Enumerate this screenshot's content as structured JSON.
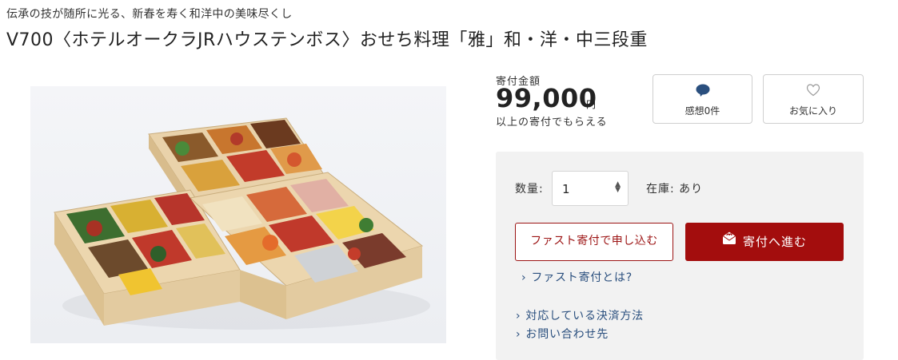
{
  "header": {
    "subtitle": "伝承の技が随所に光る、新春を寿く和洋中の美味尽くし",
    "title": "V700〈ホテルオークラJRハウステンボス〉おせち料理「雅」和・洋・中三段重"
  },
  "price": {
    "label": "寄付金額",
    "amount": "99,000",
    "unit": "円",
    "note": "以上の寄付でもらえる"
  },
  "actions": {
    "thanks_label": "感想0件",
    "thanks_icon": "speech-bubble-icon",
    "favorite_label": "お気に入り",
    "favorite_icon": "heart-outline-icon"
  },
  "order": {
    "quantity_label": "数量:",
    "quantity_value": "1",
    "stock_text": "在庫: あり",
    "fast_button": "ファスト寄付で申し込む",
    "donate_button": "寄付へ進む",
    "donate_icon": "gift-envelope-icon",
    "fast_link": "ファスト寄付とは?",
    "payment_link": "対応している決済方法",
    "contact_link": "お問い合わせ先"
  },
  "colors": {
    "accent": "#a30d0d",
    "link": "#2a4f7e",
    "panel_bg": "#f2f2f2"
  }
}
